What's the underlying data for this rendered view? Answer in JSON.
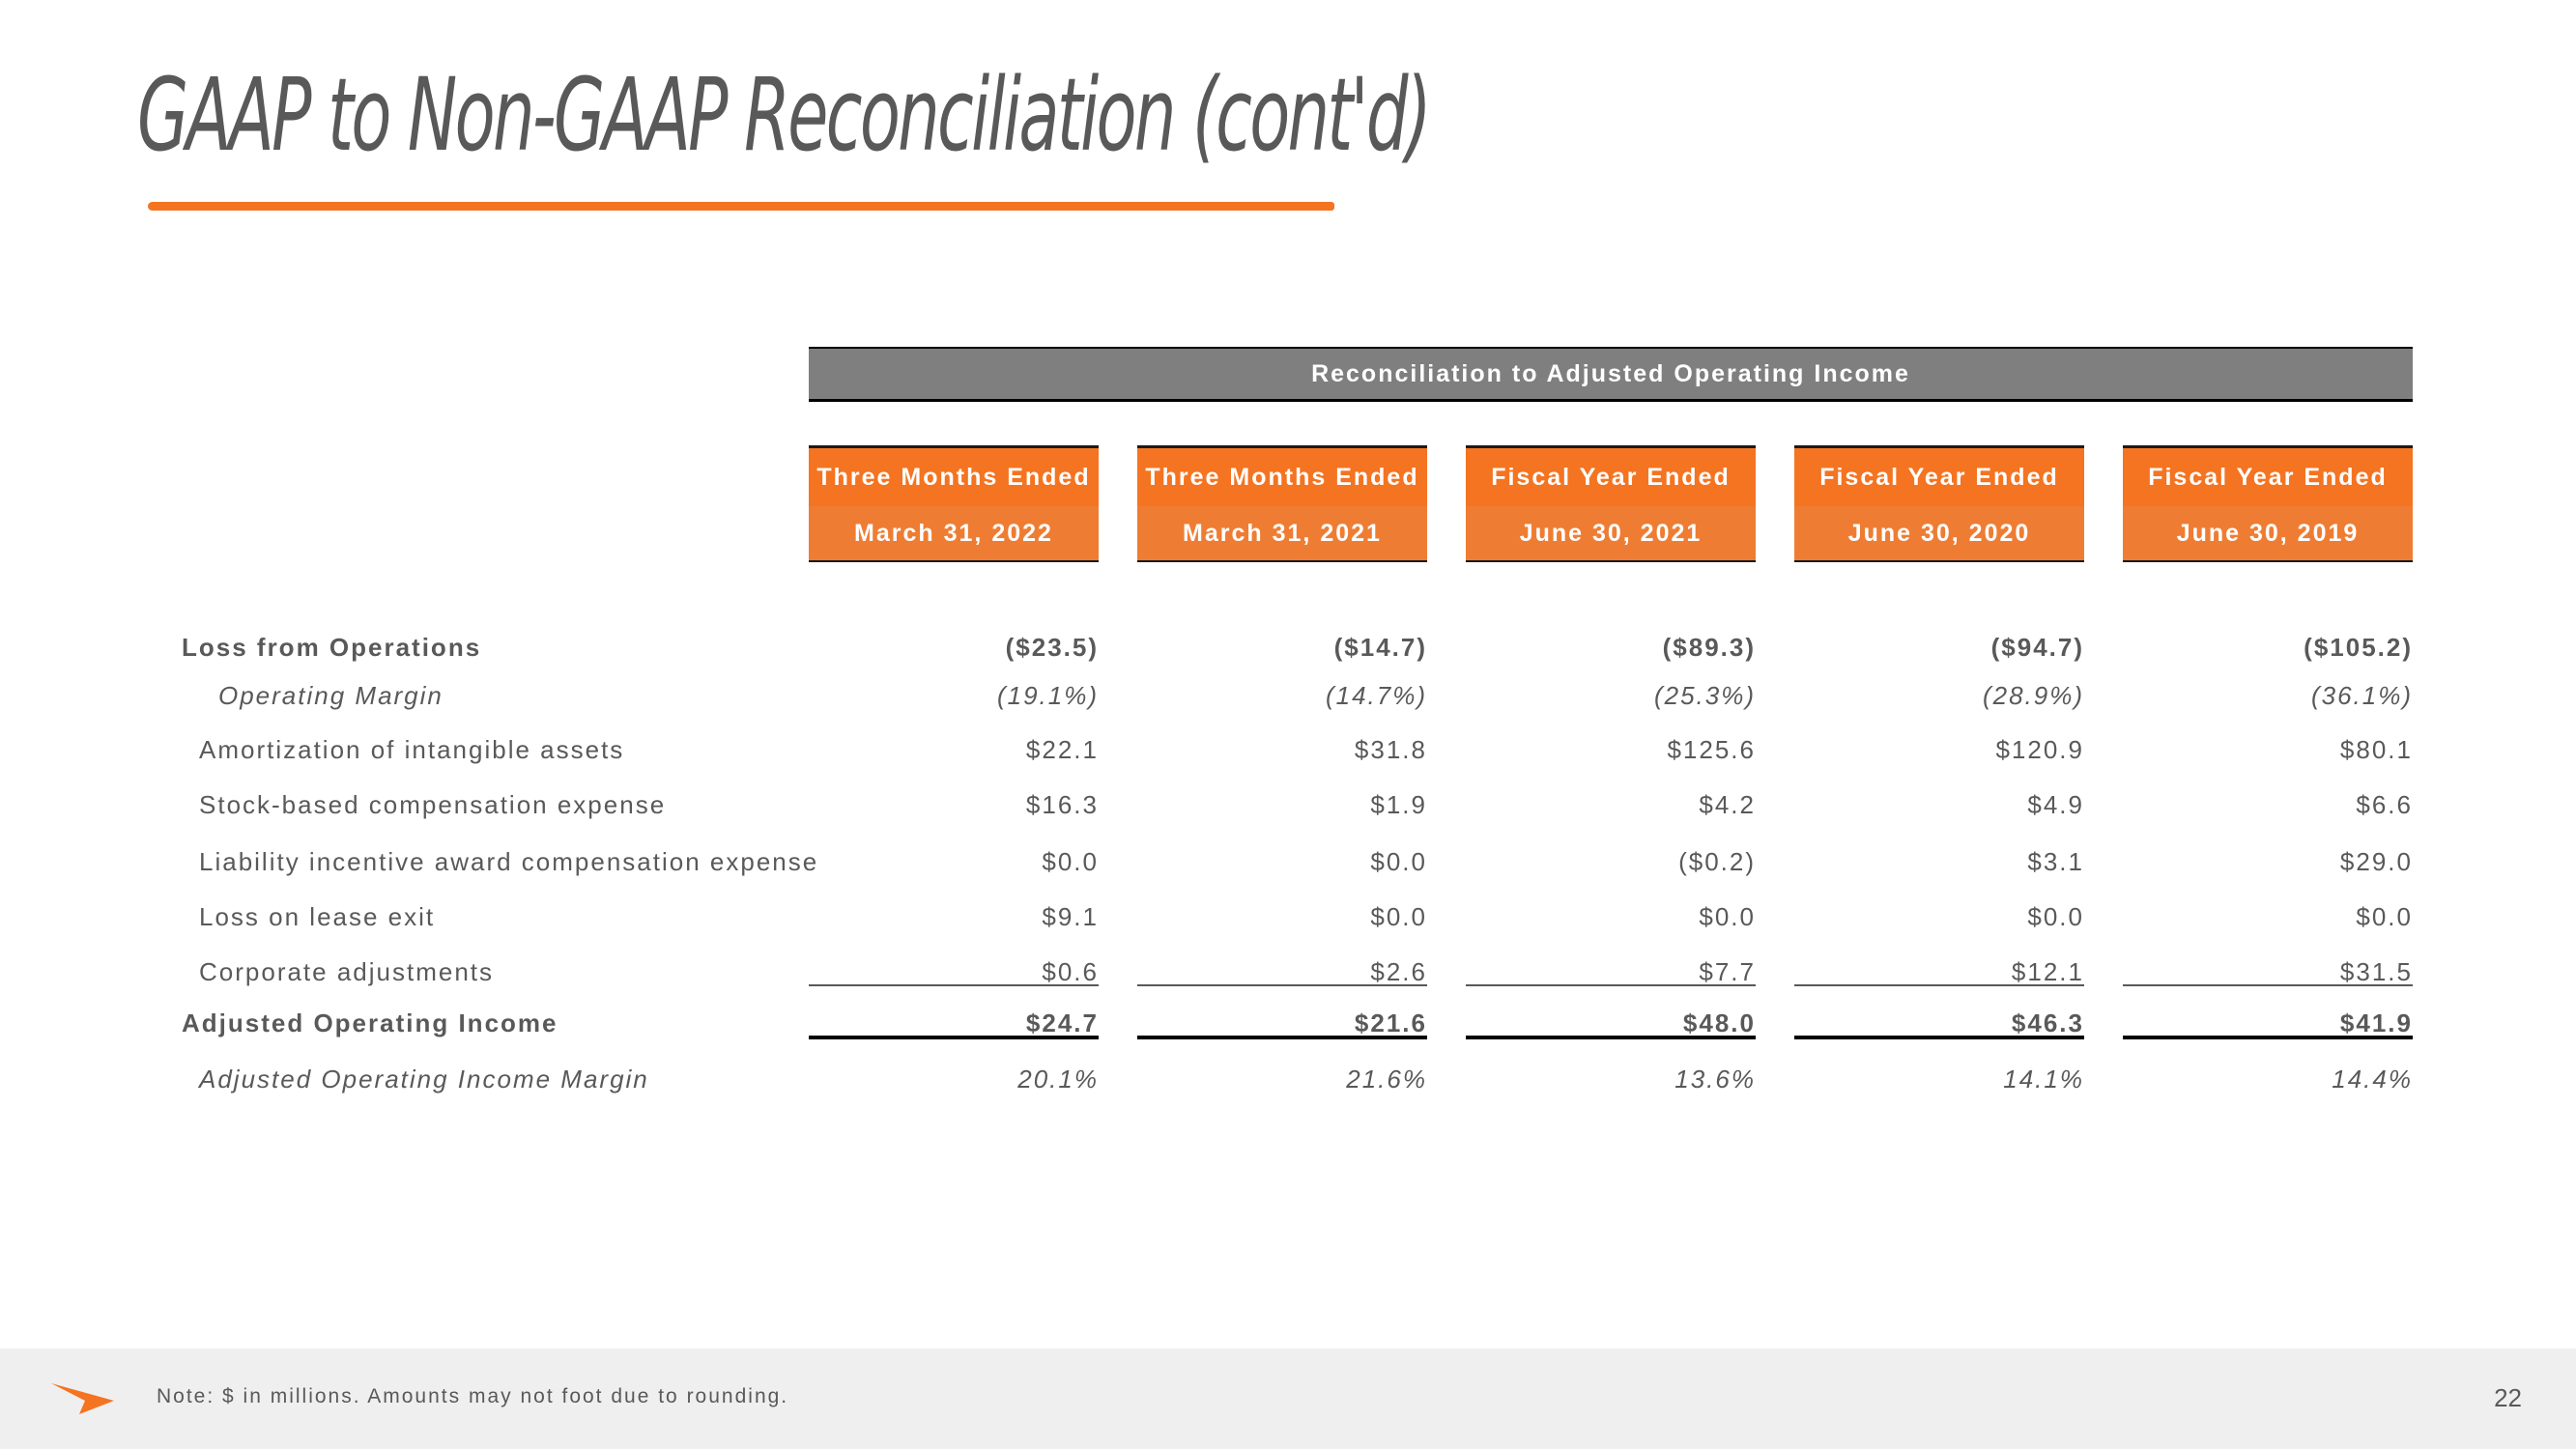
{
  "page": {
    "title": "GAAP to Non-GAAP Reconciliation (cont'd)",
    "accent_color": "#F47421",
    "page_number": "22"
  },
  "table": {
    "section_title": "Reconciliation to Adjusted Operating Income",
    "columns": [
      {
        "line1": "Three Months Ended",
        "line2": "March 31, 2022"
      },
      {
        "line1": "Three Months Ended",
        "line2": "March 31, 2021"
      },
      {
        "line1": "Fiscal Year Ended",
        "line2": "June 30, 2021"
      },
      {
        "line1": "Fiscal Year Ended",
        "line2": "June 30, 2020"
      },
      {
        "line1": "Fiscal Year Ended",
        "line2": "June 30, 2019"
      }
    ],
    "rows": [
      {
        "label": "Loss from Operations",
        "style": "bold",
        "values": [
          "($23.5)",
          "($14.7)",
          "($89.3)",
          "($94.7)",
          "($105.2)"
        ]
      },
      {
        "label": "Operating Margin",
        "style": "italic",
        "values": [
          "(19.1%)",
          "(14.7%)",
          "(25.3%)",
          "(28.9%)",
          "(36.1%)"
        ]
      },
      {
        "label": "Amortization of intangible assets",
        "style": "normal",
        "values": [
          "$22.1",
          "$31.8",
          "$125.6",
          "$120.9",
          "$80.1"
        ]
      },
      {
        "label": "Stock-based compensation expense",
        "style": "normal",
        "values": [
          "$16.3",
          "$1.9",
          "$4.2",
          "$4.9",
          "$6.6"
        ]
      },
      {
        "label": "Liability incentive award compensation expense",
        "style": "normal",
        "values": [
          "$0.0",
          "$0.0",
          "($0.2)",
          "$3.1",
          "$29.0"
        ]
      },
      {
        "label": "Loss on lease exit",
        "style": "normal",
        "values": [
          "$9.1",
          "$0.0",
          "$0.0",
          "$0.0",
          "$0.0"
        ]
      },
      {
        "label": "Corporate adjustments",
        "style": "normal",
        "values": [
          "$0.6",
          "$2.6",
          "$7.7",
          "$12.1",
          "$31.5"
        ]
      },
      {
        "label": "Adjusted Operating Income",
        "style": "bold",
        "values": [
          "$24.7",
          "$21.6",
          "$48.0",
          "$46.3",
          "$41.9"
        ]
      },
      {
        "label": "Adjusted Operating Income Margin",
        "style": "italic",
        "values": [
          "20.1%",
          "21.6%",
          "13.6%",
          "14.1%",
          "14.4%"
        ]
      }
    ]
  },
  "footer": {
    "logo_icon": "arrow-logo-icon",
    "note": "Note: $ in millions. Amounts may not foot due to rounding."
  }
}
